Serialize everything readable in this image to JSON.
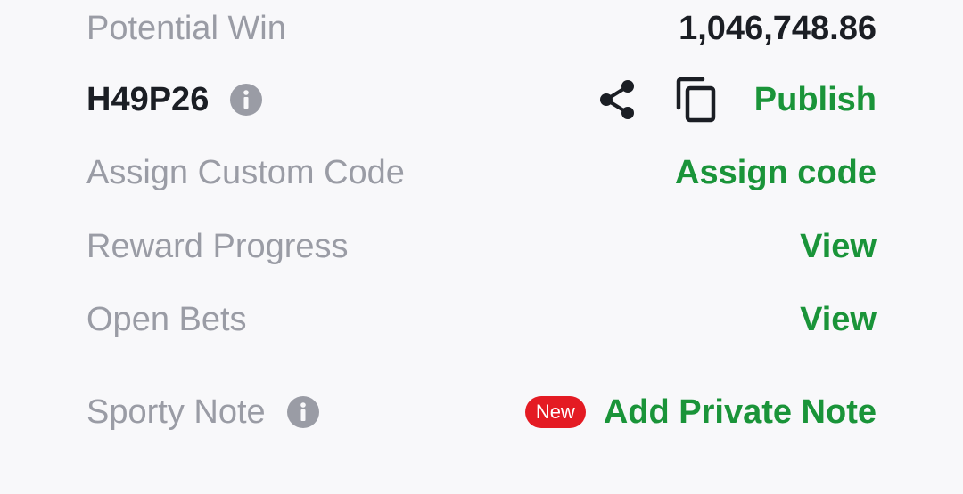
{
  "potential_win": {
    "label": "Potential Win",
    "value": "1,046,748.86"
  },
  "booking": {
    "code": "H49P26",
    "info_icon": "info-icon",
    "share_icon": "share-icon",
    "copy_icon": "copy-icon",
    "publish_label": "Publish"
  },
  "custom_code": {
    "label": "Assign Custom Code",
    "action": "Assign code"
  },
  "reward_progress": {
    "label": "Reward Progress",
    "action": "View"
  },
  "open_bets": {
    "label": "Open Bets",
    "action": "View"
  },
  "sporty_note": {
    "label": "Sporty Note",
    "info_icon": "info-icon",
    "badge": "New",
    "action": "Add Private Note"
  },
  "colors": {
    "background": "#f8f8fa",
    "label_gray": "#9a9ca5",
    "text_dark": "#1b1e24",
    "accent_green": "#1a9439",
    "badge_red": "#e41b23"
  }
}
